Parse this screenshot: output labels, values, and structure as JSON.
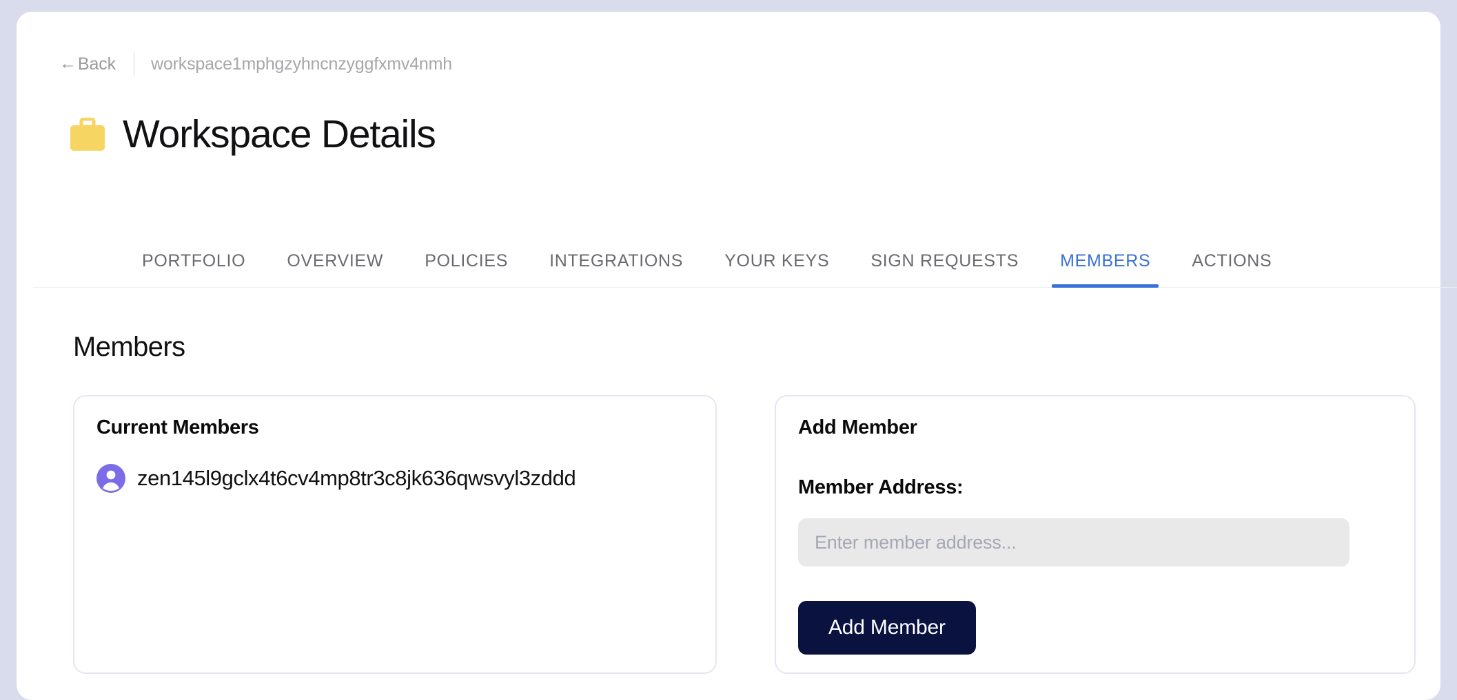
{
  "theme": {
    "page_background": "#d9dcec",
    "card_background": "#ffffff",
    "accent_blue": "#3b72d9",
    "button_navy": "#0a1240",
    "avatar_purple": "#7c6ce8",
    "briefcase_yellow": "#f6d563",
    "panel_border": "#e4e7f2",
    "input_background": "#e9e9ea",
    "muted_text": "#9a9a9e"
  },
  "breadcrumb": {
    "back_label": "Back",
    "back_arrow": "←",
    "workspace_id": "workspace1mphgzyhncnzyggfxmv4nmh"
  },
  "header": {
    "icon": "briefcase-icon",
    "title": "Workspace Details"
  },
  "tabs": [
    {
      "label": "PORTFOLIO",
      "active": false
    },
    {
      "label": "OVERVIEW",
      "active": false
    },
    {
      "label": "POLICIES",
      "active": false
    },
    {
      "label": "INTEGRATIONS",
      "active": false
    },
    {
      "label": "YOUR KEYS",
      "active": false
    },
    {
      "label": "SIGN REQUESTS",
      "active": false
    },
    {
      "label": "MEMBERS",
      "active": true
    },
    {
      "label": "ACTIONS",
      "active": false
    }
  ],
  "main": {
    "section_title": "Members",
    "current_members": {
      "heading": "Current Members",
      "members": [
        {
          "avatar": "user-avatar-icon",
          "address": "zen145l9gclx4t6cv4mp8tr3c8jk636qwsvyl3zddd"
        }
      ]
    },
    "add_member": {
      "heading": "Add Member",
      "field_label": "Member Address:",
      "input_value": "",
      "input_placeholder": "Enter member address...",
      "submit_label": "Add Member"
    }
  }
}
